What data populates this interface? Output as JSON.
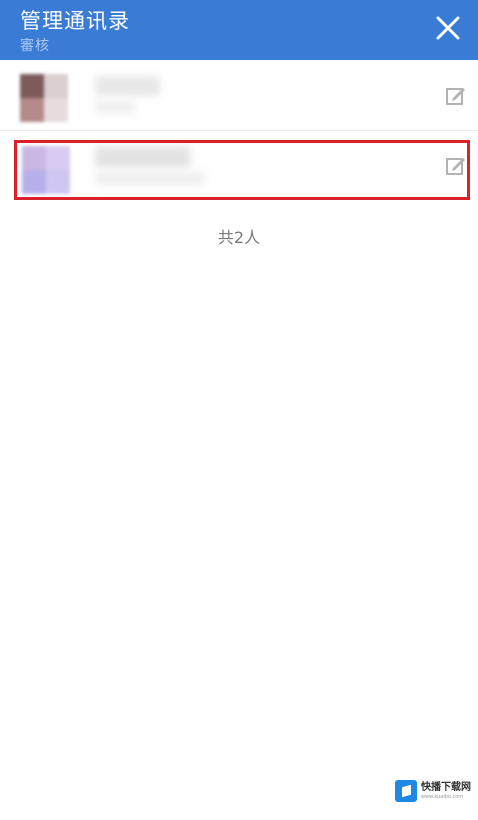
{
  "header": {
    "title": "管理通讯录",
    "subtitle": "審核",
    "close_icon": "close-icon"
  },
  "contacts": [
    {
      "avatar_colors": [
        "#7d5a5a",
        "#c2b3b3",
        "#b58a8a",
        "#d9cfcf"
      ],
      "edit_icon": "edit-icon",
      "highlighted": false
    },
    {
      "avatar_colors": [
        "#c9b8e3",
        "#d7ccf0",
        "#b7b0ea",
        "#cfc6f2"
      ],
      "edit_icon": "edit-icon",
      "highlighted": true
    }
  ],
  "footer": {
    "count_text": "共2人"
  },
  "watermark": {
    "text": "快播下载网",
    "sub": "www.kuaibo.com"
  },
  "colors": {
    "header_bg": "#3a7bd5",
    "highlight": "#d9202b"
  }
}
